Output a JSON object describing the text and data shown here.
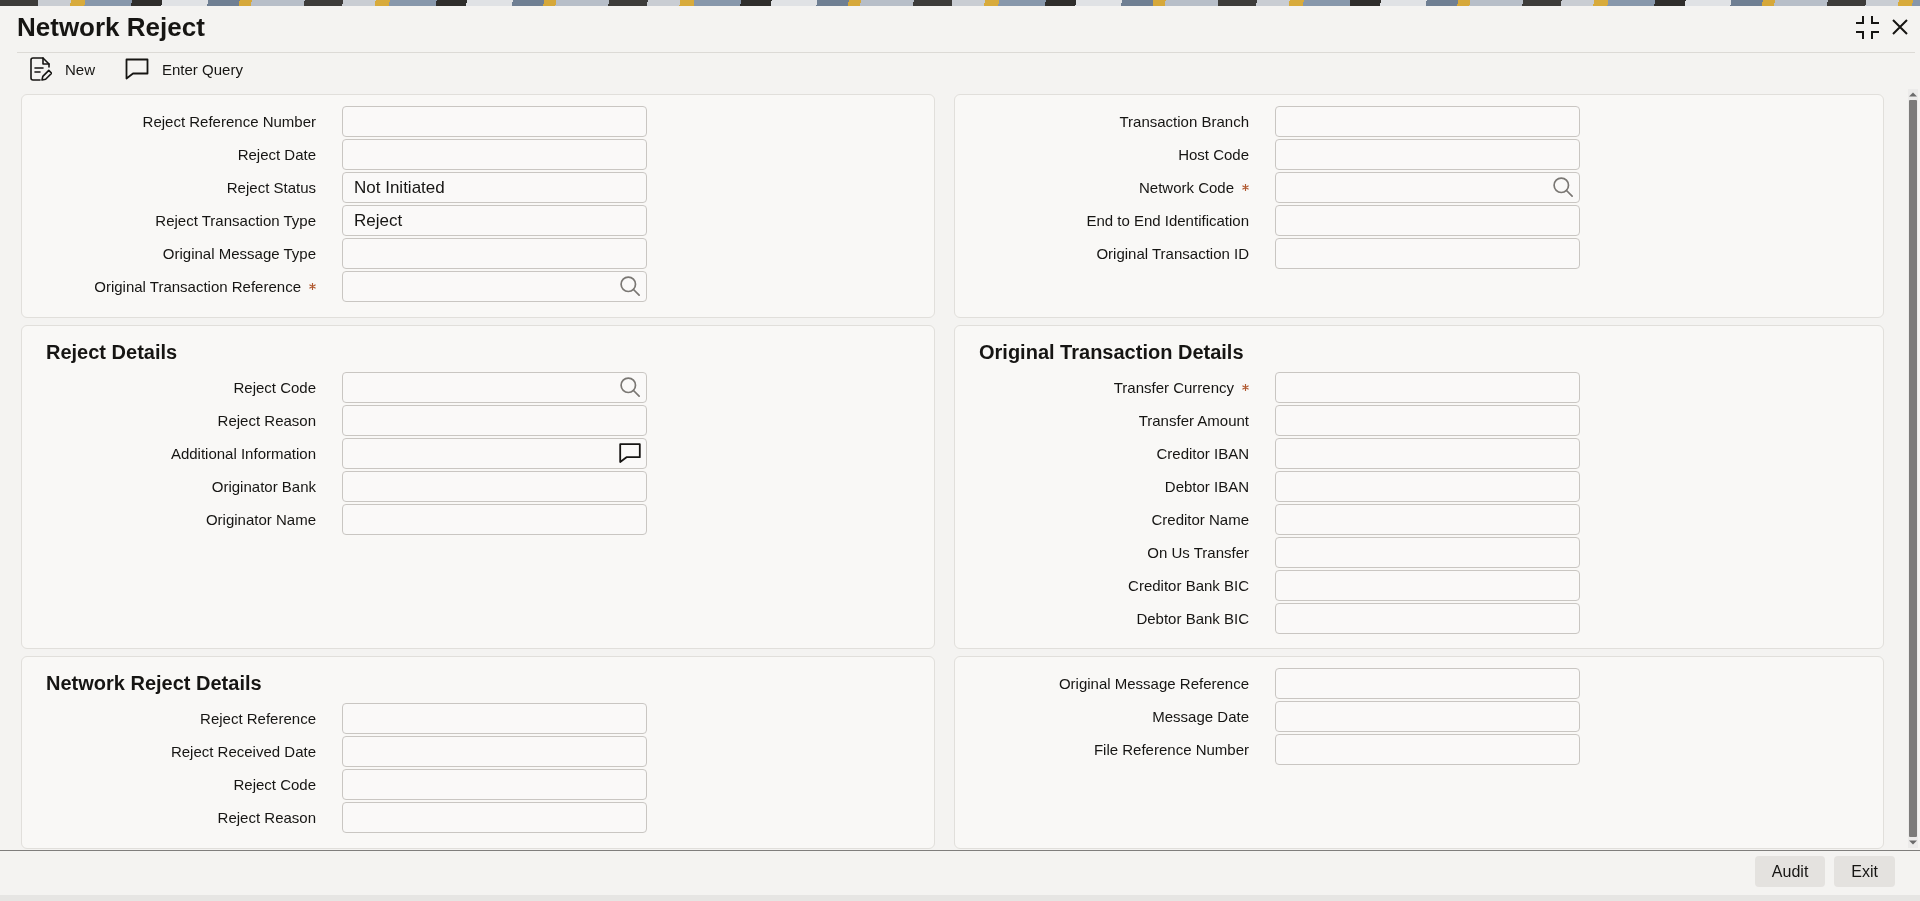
{
  "window": {
    "title": "Network Reject"
  },
  "toolbar": [
    {
      "label": "New",
      "kind": "new"
    },
    {
      "label": "Enter Query",
      "kind": "query"
    }
  ],
  "sections": [
    {
      "fields": [
        {
          "label": "Reject Reference Number",
          "required": false,
          "kind": "text"
        },
        {
          "label": "Reject Date",
          "required": false,
          "kind": "text"
        },
        {
          "label": "Reject Status",
          "required": false,
          "kind": "text",
          "value": "Not Initiated"
        },
        {
          "label": "Reject Transaction Type",
          "required": false,
          "kind": "text",
          "value": "Reject"
        },
        {
          "label": "Original Message Type",
          "required": false,
          "kind": "text"
        },
        {
          "label": "Original Transaction Reference",
          "required": true,
          "kind": "lookup"
        }
      ]
    },
    {
      "fields": [
        {
          "label": "Transaction Branch",
          "required": false,
          "kind": "text"
        },
        {
          "label": "Host Code",
          "required": false,
          "kind": "text"
        },
        {
          "label": "Network Code",
          "required": true,
          "kind": "lookup"
        },
        {
          "label": "End to End Identification",
          "required": false,
          "kind": "text"
        },
        {
          "label": "Original Transaction ID",
          "required": false,
          "kind": "text"
        }
      ]
    },
    {
      "title": "Reject Details",
      "fields": [
        {
          "label": "Reject Code",
          "required": false,
          "kind": "lookup"
        },
        {
          "label": "Reject Reason",
          "required": false,
          "kind": "text"
        },
        {
          "label": "Additional Information",
          "required": false,
          "kind": "note"
        },
        {
          "label": "Originator Bank",
          "required": false,
          "kind": "text"
        },
        {
          "label": "Originator Name",
          "required": false,
          "kind": "text"
        }
      ]
    },
    {
      "title": "Original Transaction Details",
      "fields": [
        {
          "label": "Transfer Currency",
          "required": true,
          "kind": "text"
        },
        {
          "label": "Transfer Amount",
          "required": false,
          "kind": "text"
        },
        {
          "label": "Creditor IBAN",
          "required": false,
          "kind": "text"
        },
        {
          "label": "Debtor IBAN",
          "required": false,
          "kind": "text"
        },
        {
          "label": "Creditor Name",
          "required": false,
          "kind": "text"
        },
        {
          "label": "On Us Transfer",
          "required": false,
          "kind": "text"
        },
        {
          "label": "Creditor Bank BIC",
          "required": false,
          "kind": "text"
        },
        {
          "label": "Debtor Bank BIC",
          "required": false,
          "kind": "text"
        }
      ]
    },
    {
      "title": "Network Reject Details",
      "fields": [
        {
          "label": "Reject Reference",
          "required": false,
          "kind": "text"
        },
        {
          "label": "Reject Received Date",
          "required": false,
          "kind": "text"
        },
        {
          "label": "Reject Code",
          "required": false,
          "kind": "text"
        },
        {
          "label": "Reject Reason",
          "required": false,
          "kind": "text"
        }
      ]
    },
    {
      "fields": [
        {
          "label": "Original Message Reference",
          "required": false,
          "kind": "text"
        },
        {
          "label": "Message Date",
          "required": false,
          "kind": "text"
        },
        {
          "label": "File Reference Number",
          "required": false,
          "kind": "text"
        }
      ]
    }
  ],
  "footer_buttons": [
    "Audit",
    "Exit"
  ]
}
